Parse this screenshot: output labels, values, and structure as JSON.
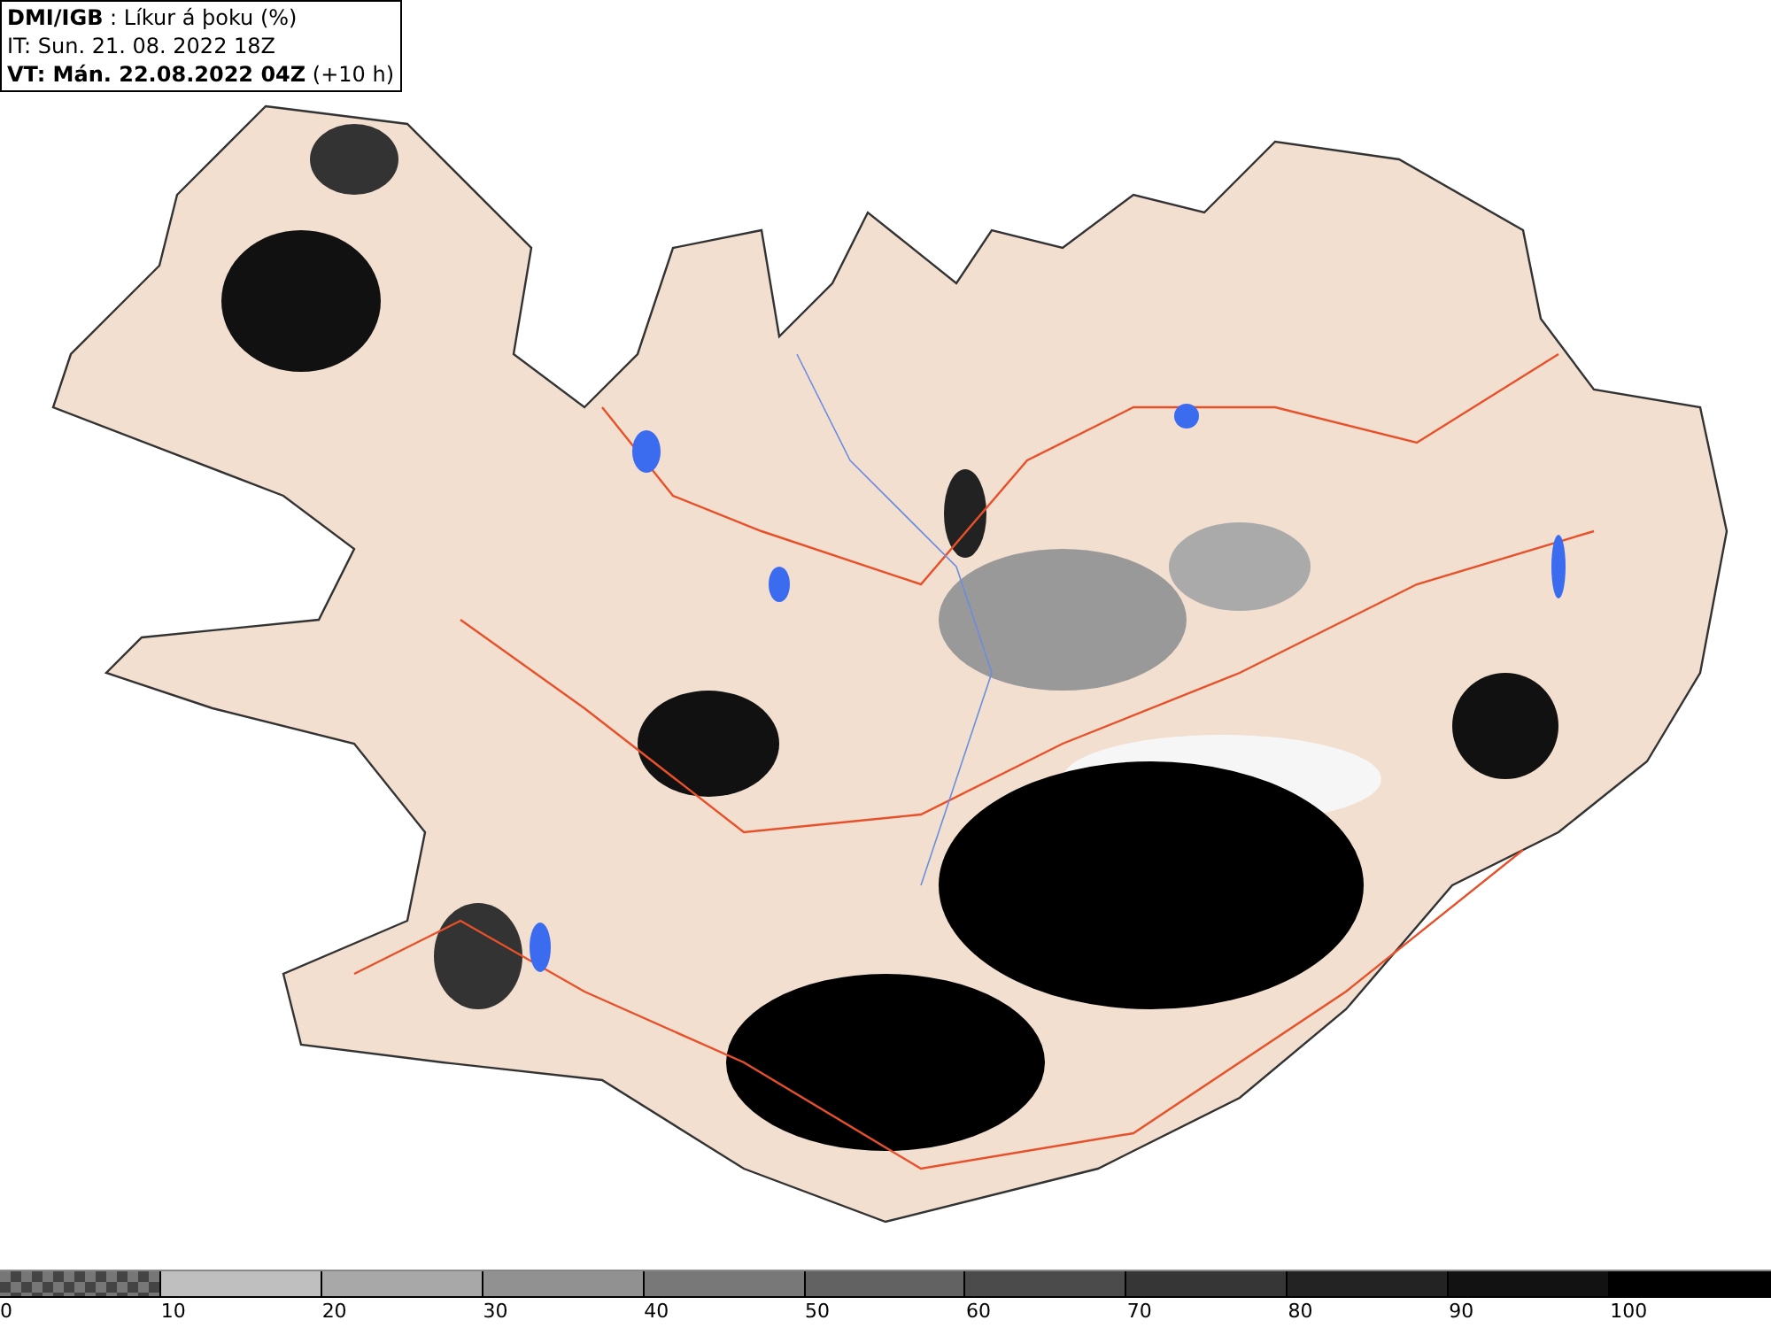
{
  "header": {
    "lines": [
      "**DMI/IGB** : Líkur á þoku (%)",
      "IT: Sun. 21. 08. 2022 18Z",
      "**VT: Mán. 22.08.2022 04Z** (+10 h)"
    ]
  },
  "legend": {
    "bins": [
      {
        "label": "0",
        "kind": "checker"
      },
      {
        "label": "10",
        "kind": "solid",
        "color": "#bfbfbf"
      },
      {
        "label": "20",
        "kind": "solid",
        "color": "#a8a8a8"
      },
      {
        "label": "30",
        "kind": "solid",
        "color": "#919191"
      },
      {
        "label": "40",
        "kind": "solid",
        "color": "#787878"
      },
      {
        "label": "50",
        "kind": "solid",
        "color": "#626262"
      },
      {
        "label": "60",
        "kind": "solid",
        "color": "#4b4b4b"
      },
      {
        "label": "70",
        "kind": "solid",
        "color": "#363636"
      },
      {
        "label": "80",
        "kind": "solid",
        "color": "#232323"
      },
      {
        "label": "90",
        "kind": "solid",
        "color": "#121212"
      },
      {
        "label": "100",
        "kind": "solid",
        "color": "#000000"
      }
    ]
  }
}
